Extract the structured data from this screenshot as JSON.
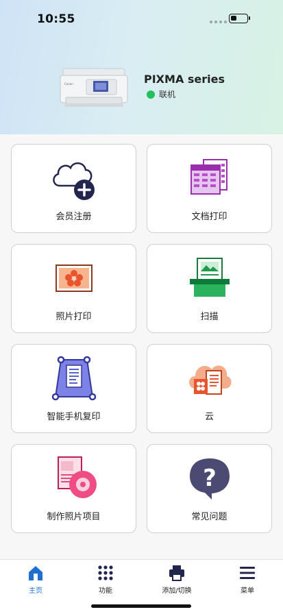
{
  "status_bar": {
    "time": "10:55"
  },
  "printer": {
    "name": "PIXMA series",
    "status": "联机"
  },
  "tiles": [
    {
      "label": "会员注册",
      "icon": "cloud-plus-icon"
    },
    {
      "label": "文档打印",
      "icon": "document-print-icon"
    },
    {
      "label": "照片打印",
      "icon": "photo-print-icon"
    },
    {
      "label": "扫描",
      "icon": "scan-icon"
    },
    {
      "label": "智能手机复印",
      "icon": "smartphone-copy-icon"
    },
    {
      "label": "云",
      "icon": "cloud-icon"
    },
    {
      "label": "制作照片项目",
      "icon": "photo-project-icon"
    },
    {
      "label": "常见问题",
      "icon": "faq-icon"
    }
  ],
  "tabbar": {
    "items": [
      {
        "label": "主页",
        "icon": "home-icon",
        "active": true
      },
      {
        "label": "功能",
        "icon": "grid-icon"
      },
      {
        "label": "添加/切换",
        "icon": "printer-icon"
      },
      {
        "label": "菜单",
        "icon": "menu-icon"
      }
    ]
  },
  "colors": {
    "accent": "#1f6fd1",
    "online": "#22c05a",
    "brand_navy": "#22254d"
  }
}
